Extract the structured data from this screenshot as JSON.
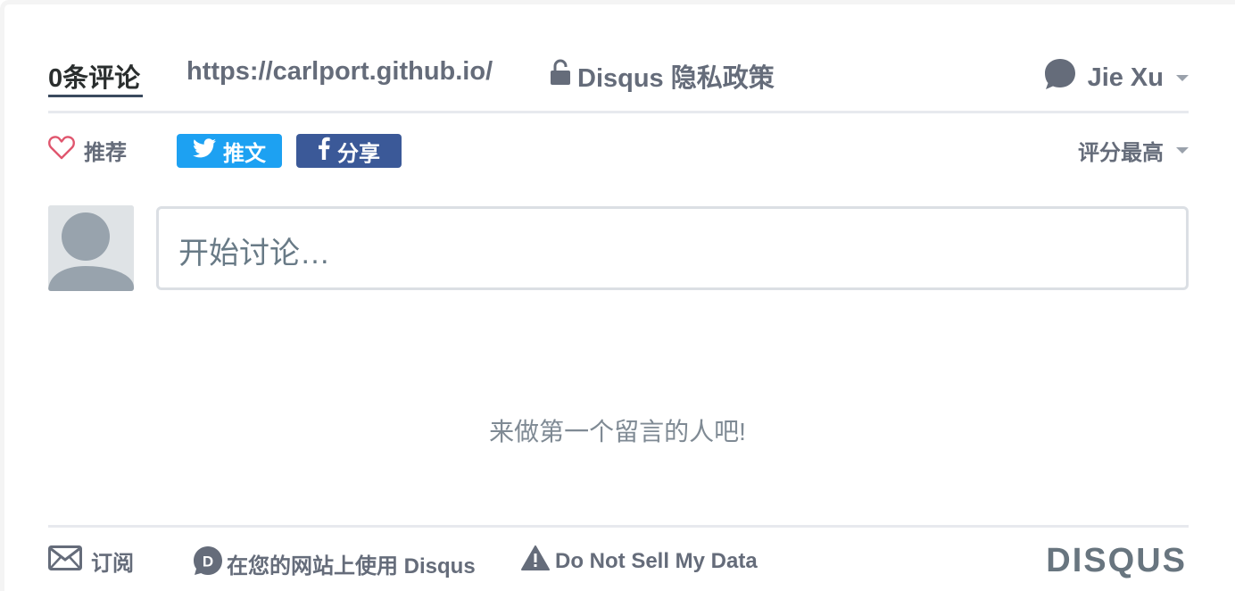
{
  "nav": {
    "comment_count": "0条评论",
    "site_url": "https://carlport.github.io/",
    "privacy_policy": "Disqus 隐私政策",
    "user_name": "Jie Xu"
  },
  "actions": {
    "recommend": "推荐",
    "tweet": "推文",
    "share": "分享",
    "sort": "评分最高"
  },
  "composer": {
    "placeholder": "开始讨论…"
  },
  "empty_state": "来做第一个留言的人吧!",
  "footer": {
    "subscribe": "订阅",
    "add_disqus": "在您的网站上使用 Disqus",
    "do_not_sell": "Do Not Sell My Data",
    "brand": "DISQUS"
  },
  "colors": {
    "twitter": "#1da1f2",
    "facebook": "#3b5998",
    "text_muted": "#656c7a",
    "heart": "#e0566e"
  }
}
